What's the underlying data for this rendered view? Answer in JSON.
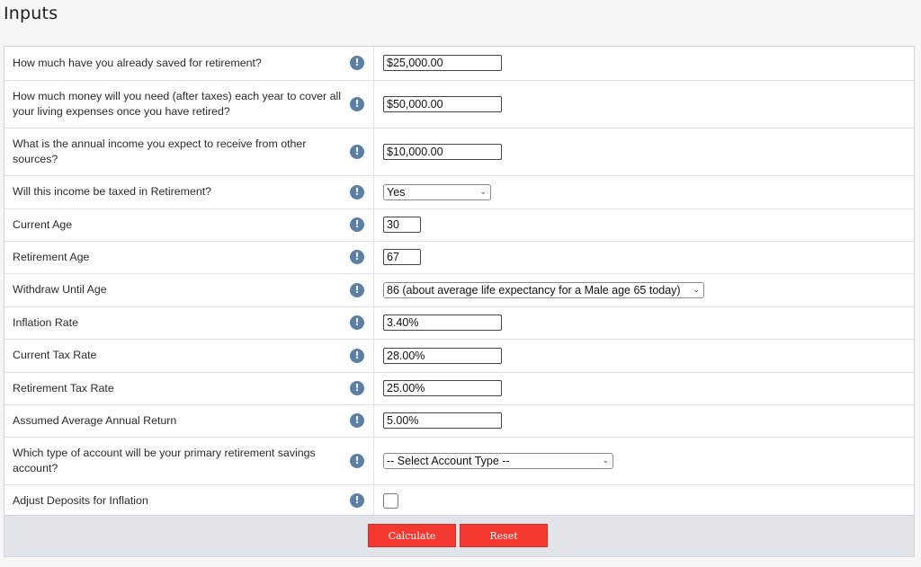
{
  "page": {
    "title": "Inputs"
  },
  "rows": [
    {
      "label": "How much have you already saved for retirement?",
      "control": "text",
      "value": "$25,000.00"
    },
    {
      "label": "How much money will you need (after taxes) each year to cover all your living expenses once you have retired?",
      "control": "text",
      "value": "$50,000.00"
    },
    {
      "label": "What is the annual income you expect to receive from other sources?",
      "control": "text",
      "value": "$10,000.00"
    },
    {
      "label": "Will this income be taxed in Retirement?",
      "control": "select",
      "value": "Yes"
    },
    {
      "label": "Current Age",
      "control": "text-short",
      "value": "30"
    },
    {
      "label": "Retirement Age",
      "control": "text-short",
      "value": "67"
    },
    {
      "label": "Withdraw Until Age",
      "control": "select",
      "value": "86 (about average life expectancy for a Male age 65 today)"
    },
    {
      "label": "Inflation Rate",
      "control": "text",
      "value": "3.40%"
    },
    {
      "label": "Current Tax Rate",
      "control": "text",
      "value": "28.00%"
    },
    {
      "label": "Retirement Tax Rate",
      "control": "text",
      "value": "25.00%"
    },
    {
      "label": "Assumed Average Annual Return",
      "control": "text",
      "value": "5.00%"
    },
    {
      "label": "Which type of account will be your primary retirement savings account?",
      "control": "select",
      "value": "-- Select Account Type --"
    },
    {
      "label": "Adjust Deposits for Inflation",
      "control": "checkbox",
      "checked": false
    }
  ],
  "info_icon": {
    "glyph": "!",
    "icon": "info-icon",
    "color": "#5c7fa6"
  },
  "select_arrow": "⌄",
  "buttons": {
    "calculate": "Calculate",
    "reset": "Reset",
    "color": "#f2382f"
  }
}
